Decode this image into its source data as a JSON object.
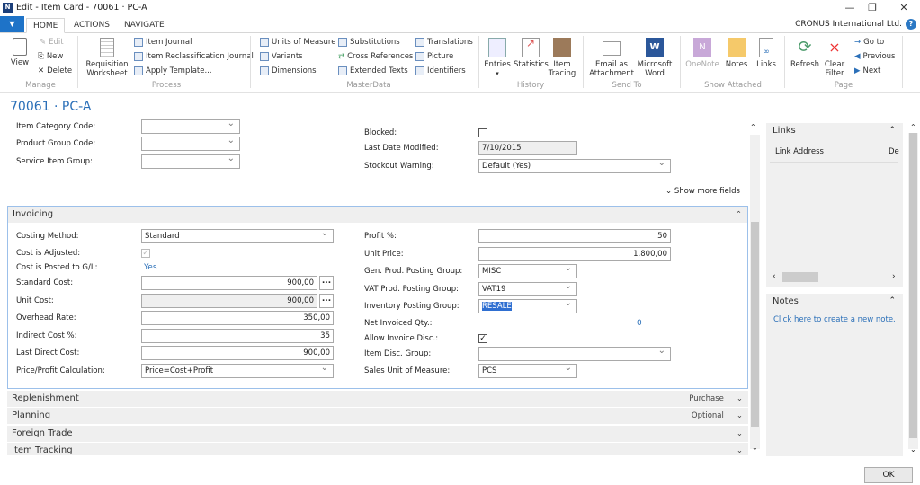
{
  "window": {
    "title": "Edit - Item Card - 70061 · PC-A",
    "minimize": "—",
    "restore": "❐",
    "close": "✕",
    "app_icon": "Dynamics NAV logo"
  },
  "tabs": [
    {
      "label": "HOME",
      "active": true
    },
    {
      "label": "ACTIONS"
    },
    {
      "label": "NAVIGATE"
    }
  ],
  "company": "CRONUS International Ltd.",
  "help_icon": "?",
  "ribbon": {
    "manage": {
      "label": "Manage",
      "view": "View",
      "edit": "Edit",
      "new": "New",
      "delete": "Delete"
    },
    "process": {
      "label": "Process",
      "requisition": "Requisition Worksheet",
      "item_journal": "Item Journal",
      "reclass": "Item Reclassification Journal",
      "apply_template": "Apply Template..."
    },
    "masterdata": {
      "label": "MasterData",
      "units": "Units of Measure",
      "variants": "Variants",
      "dimensions": "Dimensions",
      "substitutions": "Substitutions",
      "cross_refs": "Cross References",
      "extended": "Extended Texts",
      "translations": "Translations",
      "picture": "Picture",
      "identifiers": "Identifiers"
    },
    "history": {
      "label": "History",
      "entries": "Entries",
      "statistics": "Statistics",
      "item_tracing": "Item Tracing"
    },
    "sendto": {
      "label": "Send To",
      "email": "Email as Attachment",
      "word": "Microsoft Word"
    },
    "attached": {
      "label": "Show Attached",
      "onenote": "OneNote",
      "notes": "Notes",
      "links": "Links"
    },
    "page": {
      "label": "Page",
      "refresh": "Refresh",
      "clear_filter": "Clear Filter",
      "goto": "Go to",
      "previous": "Previous",
      "next": "Next"
    }
  },
  "page_title": "70061 · PC-A",
  "general": {
    "left": [
      {
        "label": "Item Category Code:",
        "value": ""
      },
      {
        "label": "Product Group Code:",
        "value": ""
      },
      {
        "label": "Service Item Group:",
        "value": ""
      }
    ],
    "blocked": {
      "label": "Blocked:",
      "checked": false
    },
    "last_modified": {
      "label": "Last Date Modified:",
      "value": "7/10/2015"
    },
    "stockout": {
      "label": "Stockout Warning:",
      "value": "Default (Yes)"
    },
    "show_more": "Show more fields"
  },
  "invoicing": {
    "title": "Invoicing",
    "costing_method": {
      "label": "Costing Method:",
      "value": "Standard"
    },
    "cost_adjusted": {
      "label": "Cost is Adjusted:",
      "checked": true
    },
    "cost_posted": {
      "label": "Cost is Posted to G/L:",
      "value": "Yes"
    },
    "standard_cost": {
      "label": "Standard Cost:",
      "value": "900,00"
    },
    "unit_cost": {
      "label": "Unit Cost:",
      "value": "900,00"
    },
    "overhead": {
      "label": "Overhead Rate:",
      "value": "350,00"
    },
    "indirect": {
      "label": "Indirect Cost %:",
      "value": "35"
    },
    "last_direct": {
      "label": "Last Direct Cost:",
      "value": "900,00"
    },
    "price_calc": {
      "label": "Price/Profit Calculation:",
      "value": "Price=Cost+Profit"
    },
    "profit": {
      "label": "Profit %:",
      "value": "50"
    },
    "unit_price": {
      "label": "Unit Price:",
      "value": "1.800,00"
    },
    "gen_prod": {
      "label": "Gen. Prod. Posting Group:",
      "value": "MISC"
    },
    "vat_prod": {
      "label": "VAT Prod. Posting Group:",
      "value": "VAT19"
    },
    "inv_posting": {
      "label": "Inventory Posting Group:",
      "value": "RESALE"
    },
    "net_invoiced": {
      "label": "Net Invoiced Qty.:",
      "value": "0"
    },
    "allow_disc": {
      "label": "Allow Invoice Disc.:",
      "checked": true
    },
    "disc_group": {
      "label": "Item Disc. Group:",
      "value": ""
    },
    "sales_uom": {
      "label": "Sales Unit of Measure:",
      "value": "PCS"
    }
  },
  "fasttabs": [
    {
      "title": "Replenishment",
      "summary": "Purchase"
    },
    {
      "title": "Planning",
      "summary": "Optional"
    },
    {
      "title": "Foreign Trade",
      "summary": ""
    },
    {
      "title": "Item Tracking",
      "summary": ""
    }
  ],
  "links": {
    "title": "Links",
    "col1": "Link Address",
    "col2": "De"
  },
  "notes": {
    "title": "Notes",
    "create": "Click here to create a new note."
  },
  "ok": "OK",
  "colors": {
    "accent": "#2a6fb8",
    "menu_blue": "#1e73c8",
    "selection": "#2f6fd1"
  }
}
